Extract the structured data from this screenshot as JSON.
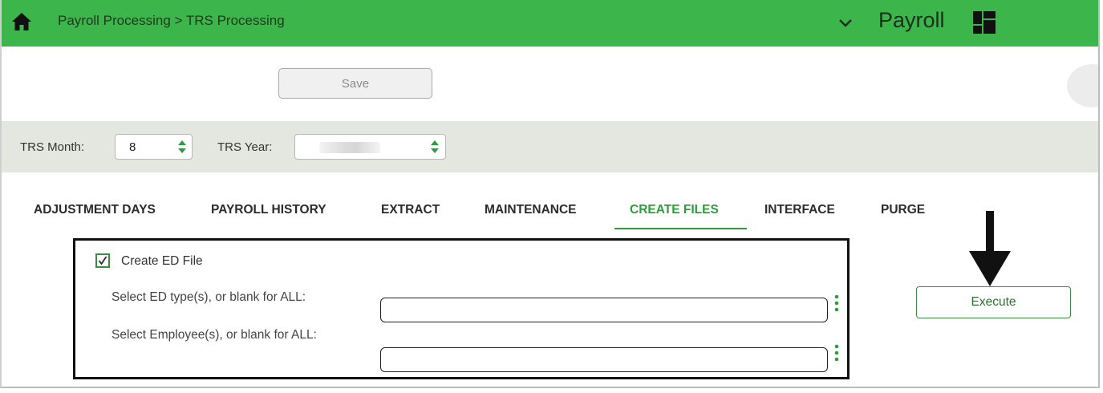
{
  "header": {
    "breadcrumb": "Payroll Processing > TRS Processing",
    "app_title": "Payroll",
    "icons": [
      "home-icon",
      "chevron-down-icon",
      "grid-icon"
    ]
  },
  "toolbar": {
    "save_label": "Save"
  },
  "filters": {
    "month_label": "TRS Month:",
    "month_value": "8",
    "year_label": "TRS Year:",
    "year_value": ""
  },
  "tabs": [
    {
      "label": "ADJUSTMENT DAYS",
      "active": false
    },
    {
      "label": "PAYROLL HISTORY",
      "active": false
    },
    {
      "label": "EXTRACT",
      "active": false
    },
    {
      "label": "MAINTENANCE",
      "active": false
    },
    {
      "label": "CREATE FILES",
      "active": true
    },
    {
      "label": "INTERFACE",
      "active": false
    },
    {
      "label": "PURGE",
      "active": false
    }
  ],
  "create_files": {
    "checkbox_label": "Create ED File",
    "checkbox_checked": true,
    "ed_type_label": "Select ED type(s), or blank for ALL:",
    "ed_type_value": "",
    "employee_label": "Select Employee(s), or blank for ALL:",
    "employee_value": "",
    "execute_label": "Execute"
  },
  "colors": {
    "header_green": "#3cb54a",
    "active_tab": "#2e9c3d",
    "filter_bar": "#e3e7df"
  }
}
